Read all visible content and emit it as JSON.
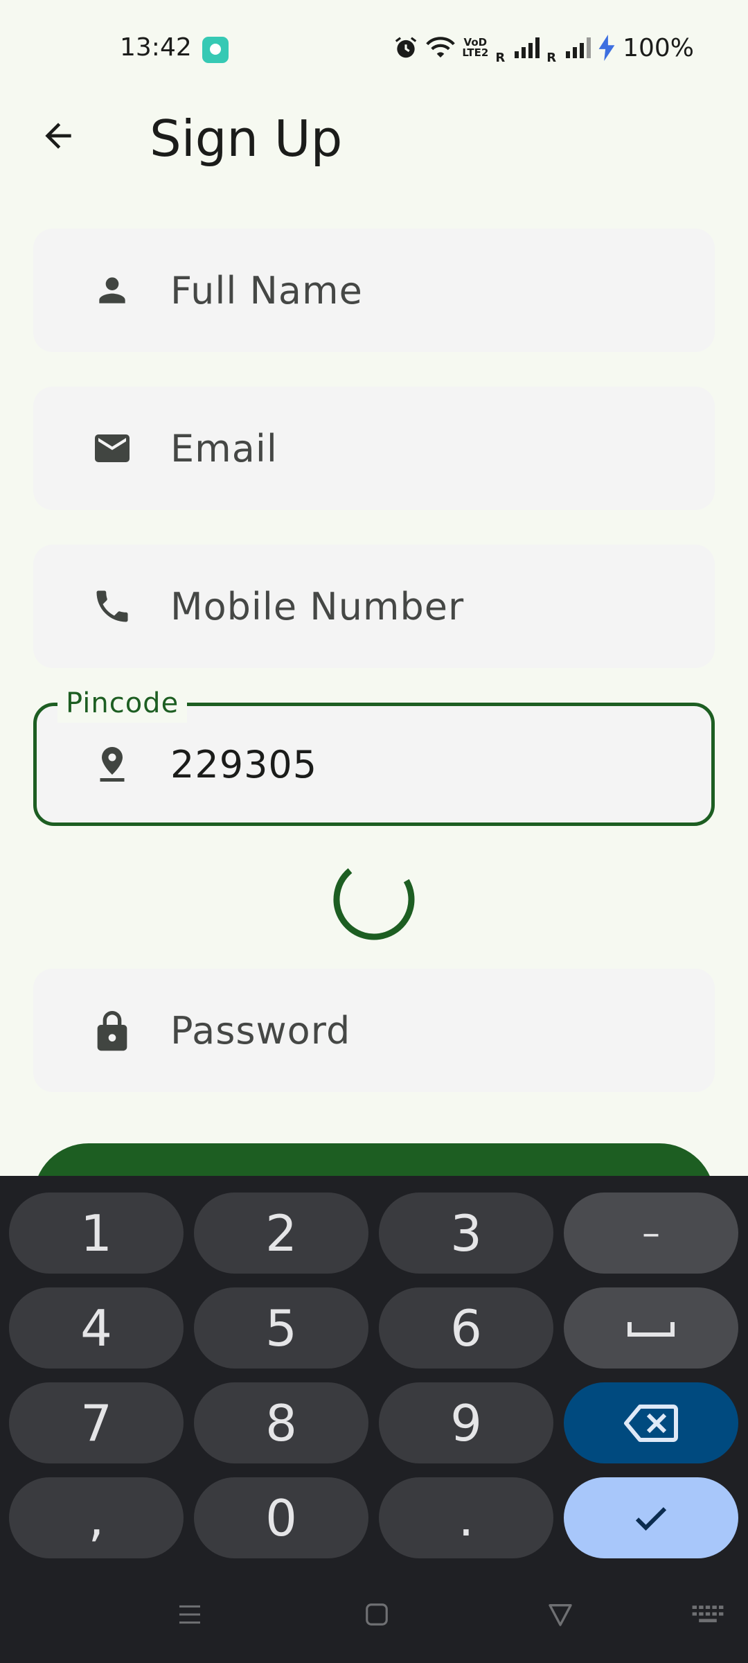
{
  "status_bar": {
    "time": "13:42",
    "volte_label": "VoD\nLTE2",
    "roaming_label": "R",
    "battery_text": "100%",
    "icons": [
      "alarm-icon",
      "wifi-icon",
      "volte-icon",
      "signal-icon",
      "signal-icon",
      "charging-icon"
    ]
  },
  "app_bar": {
    "title": "Sign Up",
    "back_icon": "arrow-left-icon"
  },
  "form": {
    "full_name": {
      "placeholder": "Full Name",
      "icon": "person-icon"
    },
    "email": {
      "placeholder": "Email",
      "icon": "mail-icon"
    },
    "mobile": {
      "placeholder": "Mobile Number",
      "icon": "phone-icon"
    },
    "pincode": {
      "label": "Pincode",
      "value": "229305",
      "icon": "location-pin-icon"
    },
    "password": {
      "placeholder": "Password",
      "icon": "lock-icon"
    }
  },
  "colors": {
    "accent": "#1d5e22",
    "background": "#f6f9f1",
    "field_fill": "#f4f4f4",
    "keyboard_bg": "#1f2024",
    "enter_key": "#a8c7fa",
    "backspace_key": "#004a7f"
  },
  "keyboard": {
    "keys": {
      "k1": "1",
      "k2": "2",
      "k3": "3",
      "dash": "–",
      "k4": "4",
      "k5": "5",
      "k6": "6",
      "k7": "7",
      "k8": "8",
      "k9": "9",
      "comma": ",",
      "k0": "0",
      "period": "."
    },
    "icons": [
      "space-icon",
      "backspace-icon",
      "check-icon"
    ]
  },
  "nav_bar": {
    "icons": [
      "menu-icon",
      "home-square-icon",
      "back-triangle-icon",
      "keyboard-icon"
    ]
  }
}
